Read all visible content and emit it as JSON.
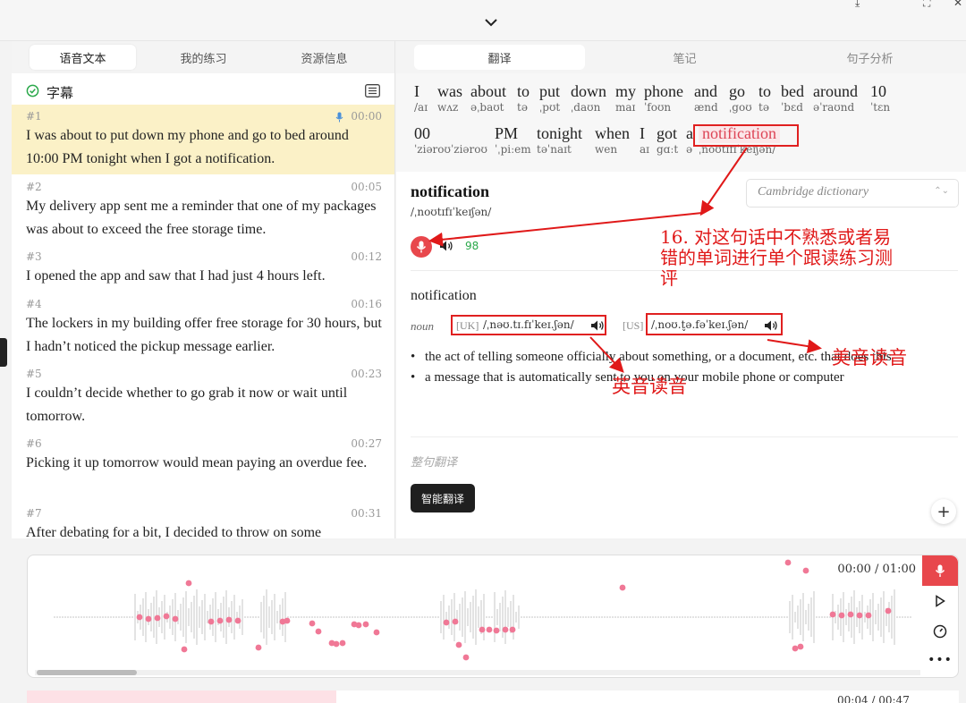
{
  "left_tabs": [
    "语音文本",
    "我的练习",
    "资源信息"
  ],
  "subtitle_header": "字幕",
  "segments": [
    {
      "num": "#1",
      "time": "00:00",
      "text": "I was about to put down my phone and go to bed around 10:00 PM tonight when I got a notification."
    },
    {
      "num": "#2",
      "time": "00:05",
      "text": "My delivery app sent me a reminder that one of my packages was about to exceed the free storage time."
    },
    {
      "num": "#3",
      "time": "00:12",
      "text": "I opened the app and saw that I had just 4 hours left."
    },
    {
      "num": "#4",
      "time": "00:16",
      "text": "The lockers in my building offer free storage for 30 hours, but I hadn’t noticed the pickup message earlier."
    },
    {
      "num": "#5",
      "time": "00:23",
      "text": "I couldn’t decide whether to go grab it now or wait until tomorrow."
    },
    {
      "num": "#6",
      "time": "00:27",
      "text": "Picking it up tomorrow would mean paying an overdue fee."
    },
    {
      "num": "#7",
      "time": "00:31",
      "text": "After debating for a bit, I decided to throw on some"
    }
  ],
  "right_tabs": [
    "翻译",
    "笔记",
    "句子分析"
  ],
  "sentence_words": [
    {
      "w": "I",
      "p": "/aɪ"
    },
    {
      "w": "was",
      "p": "wʌz"
    },
    {
      "w": "about",
      "p": "əˌbaʊt"
    },
    {
      "w": "to",
      "p": "tə"
    },
    {
      "w": "put",
      "p": "ˌpʊt"
    },
    {
      "w": "down",
      "p": "ˌdaʊn"
    },
    {
      "w": "my",
      "p": "maɪ"
    },
    {
      "w": "phone",
      "p": "ˈfoʊn"
    },
    {
      "w": "and",
      "p": "ænd"
    },
    {
      "w": "go",
      "p": "ˌgoʊ"
    },
    {
      "w": "to",
      "p": "tə"
    },
    {
      "w": "bed",
      "p": "ˈbɛd"
    },
    {
      "w": "around",
      "p": "əˈraʊnd"
    },
    {
      "w": "10",
      "p": "ˈtɛn"
    },
    {
      "w": "00",
      "p": "ˈziəroʊˈziəroʊ"
    },
    {
      "w": "PM",
      "p": "ˈˌpiːem"
    },
    {
      "w": "tonight",
      "p": "təˈnaɪt"
    },
    {
      "w": "when",
      "p": "wen"
    },
    {
      "w": "I",
      "p": "aɪ"
    },
    {
      "w": "got",
      "p": "gɑːt"
    },
    {
      "w": "a",
      "p": "ə"
    },
    {
      "w": "notification",
      "p": "ˌnoʊtɪfɪˈkeɪʃən/"
    }
  ],
  "dictionary": {
    "word": "notification",
    "phonetic": "/ˌnoʊtɪfɪˈkeɪʃən/",
    "source": "Cambridge dictionary",
    "score": "98",
    "entry_word": "notification",
    "pos": "noun",
    "uk_label": "[UK]",
    "uk_ipa": "/ˌnəʊ.tɪ.fɪˈkeɪ.ʃən/",
    "us_label": "[US]",
    "us_ipa": "/ˌnoʊ.t̬ə.fəˈkeɪ.ʃən/",
    "definitions": [
      "the act of telling someone officially about something, or a document, etc. that does this",
      "a message that is automatically sent to you on your mobile phone or computer"
    ],
    "translate_placeholder": "整句翻译",
    "ai_translate_label": "智能翻译"
  },
  "player": {
    "time": "00:00 / 01:00",
    "bottom_time": "00:04 / 00:47"
  },
  "annotations": {
    "note_main": [
      "16. 对这句话中不熟悉或者易",
      "错的单词进行单个跟读练习测",
      "评"
    ],
    "uk_note": "英音读音",
    "us_note": "美音读音"
  },
  "colors": {
    "accent_red": "#e8474c",
    "highlight_yellow": "#fbf1c7",
    "annotation_red": "#e01919",
    "score_green": "#2aa84a"
  }
}
